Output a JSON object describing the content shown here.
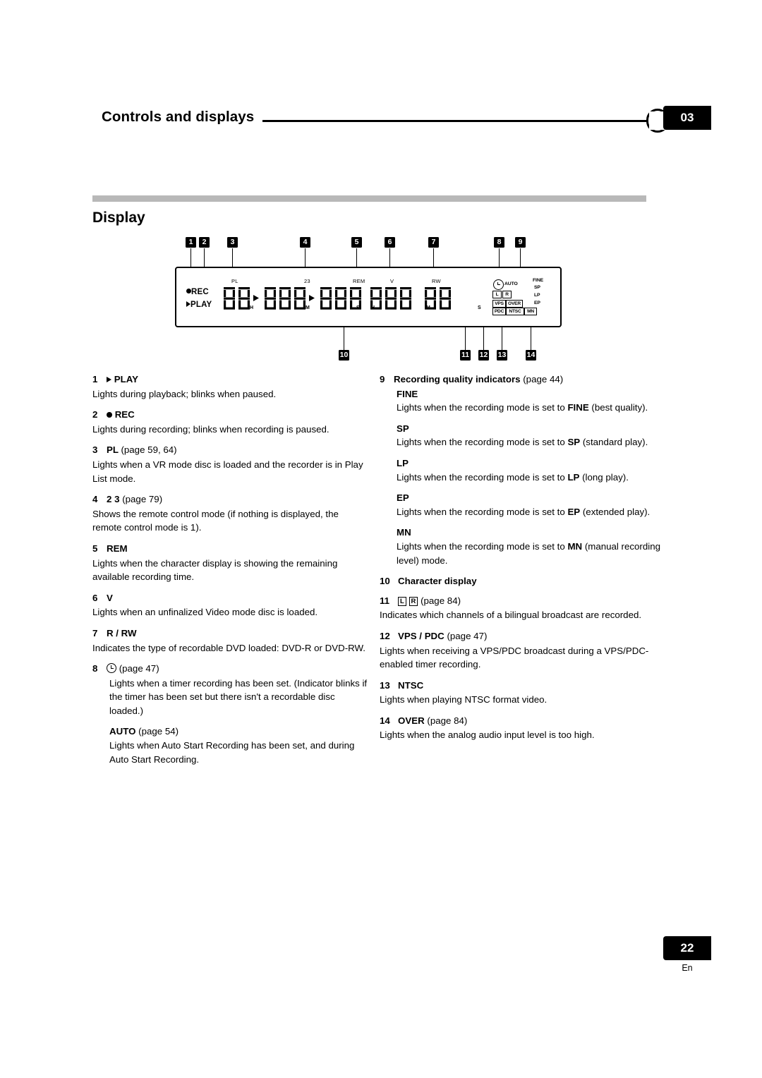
{
  "header": {
    "title": "Controls and displays",
    "chapter": "03"
  },
  "section": {
    "title": "Display"
  },
  "diagram": {
    "callouts_top": [
      "1",
      "2",
      "3",
      "4",
      "5",
      "6",
      "7",
      "8",
      "9"
    ],
    "callouts_bottom": [
      "10",
      "11",
      "12",
      "13",
      "14"
    ],
    "labels": {
      "pl": "PL",
      "mode23": "23",
      "rem": "REM",
      "v": "V",
      "rw": "RW",
      "rec": "REC",
      "play": "PLAY",
      "auto": "AUTO",
      "fine": "FINE",
      "sp": "SP",
      "lp": "LP",
      "ep": "EP",
      "mn": "MN",
      "l": "L",
      "r": "R",
      "vps": "VPS",
      "over": "OVER",
      "pdc": "PDC",
      "ntsc": "NTSC",
      "unit_h1": "H",
      "unit_m1": "M",
      "unit_s1": "S",
      "unit_h2": "H",
      "unit_m2": "M",
      "unit_s2": "S"
    }
  },
  "left_column": [
    {
      "num": "1",
      "title": "PLAY",
      "title_icon": "play-triangle",
      "page": "",
      "body": "Lights during playback; blinks when paused."
    },
    {
      "num": "2",
      "title": "REC",
      "title_icon": "rec-dot",
      "page": "",
      "body": "Lights during recording; blinks when recording is paused."
    },
    {
      "num": "3",
      "title": "PL",
      "page": "(page 59, 64)",
      "body": "Lights when a VR mode disc is loaded and the recorder is in Play List mode."
    },
    {
      "num": "4",
      "title": "2 3",
      "page": "(page 79)",
      "body": "Shows the remote control mode (if nothing is displayed, the remote control mode is 1)."
    },
    {
      "num": "5",
      "title": "REM",
      "page": "",
      "body": "Lights when the character display is showing the remaining available recording time."
    },
    {
      "num": "6",
      "title": "V",
      "page": "",
      "body": "Lights when an unfinalized Video mode disc is loaded."
    },
    {
      "num": "7",
      "title": "R / RW",
      "page": "",
      "body": "Indicates the type of recordable DVD loaded: DVD-R or DVD-RW."
    },
    {
      "num": "8",
      "title": "",
      "title_icon": "clock",
      "page": "(page 47)",
      "body": "Lights when a timer recording has been set. (Indicator blinks if the timer has been set but there isn't a recordable disc loaded.)",
      "sub_title": "AUTO",
      "sub_page": "(page 54)",
      "sub_body": "Lights when Auto Start Recording has been set, and during Auto Start Recording."
    }
  ],
  "right_column": {
    "item9": {
      "num": "9",
      "title": "Recording quality indicators",
      "page": "(page 44)",
      "subs": [
        {
          "name": "FINE",
          "body_pre": "Lights when the recording mode is set to ",
          "body_bold": "FINE",
          "body_post": " (best quality)."
        },
        {
          "name": "SP",
          "body_pre": "Lights when the recording mode is set to ",
          "body_bold": "SP",
          "body_post": " (standard play)."
        },
        {
          "name": "LP",
          "body_pre": "Lights when the recording mode is set to ",
          "body_bold": "LP",
          "body_post": " (long play)."
        },
        {
          "name": "EP",
          "body_pre": "Lights when the recording mode is set to ",
          "body_bold": "EP",
          "body_post": " (extended play)."
        },
        {
          "name": "MN",
          "body_pre": "Lights when the recording mode is set to ",
          "body_bold": "MN",
          "body_post": " (manual recording level) mode."
        }
      ]
    },
    "item10": {
      "num": "10",
      "title": "Character display"
    },
    "item11": {
      "num": "11",
      "boxes": [
        "L",
        "R"
      ],
      "page": "(page 84)",
      "body": "Indicates which channels of a bilingual broadcast are recorded."
    },
    "item12": {
      "num": "12",
      "title": "VPS / PDC",
      "page": "(page 47)",
      "body": "Lights when receiving a VPS/PDC broadcast during a VPS/PDC-enabled timer recording."
    },
    "item13": {
      "num": "13",
      "title": "NTSC",
      "page": "",
      "body": "Lights when playing NTSC format video."
    },
    "item14": {
      "num": "14",
      "title": "OVER",
      "page": "(page 84)",
      "body": "Lights when the analog audio input level is too high."
    }
  },
  "footer": {
    "page_number": "22",
    "language": "En"
  }
}
